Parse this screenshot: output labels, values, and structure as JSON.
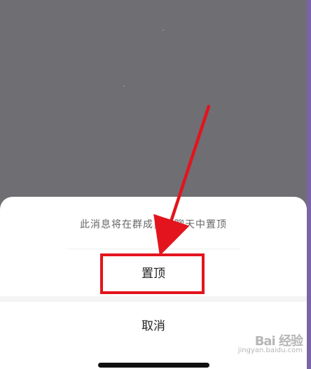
{
  "dialog": {
    "message": "此消息将在群成员的聊天中置顶",
    "pin_label": "置顶",
    "cancel_label": "取消"
  },
  "watermark": {
    "title": "Bai 经验",
    "subtitle": "jingyan.baidu.com"
  },
  "colors": {
    "overlay": "#6f6e73",
    "sheet": "#ffffff",
    "highlight": "#e3141d",
    "arrow": "#e3141d",
    "edge_accent": "#7b63a8"
  },
  "icons": {
    "annotation": "red-arrow-icon",
    "watermark_logo": "baidu-paw-logo"
  }
}
